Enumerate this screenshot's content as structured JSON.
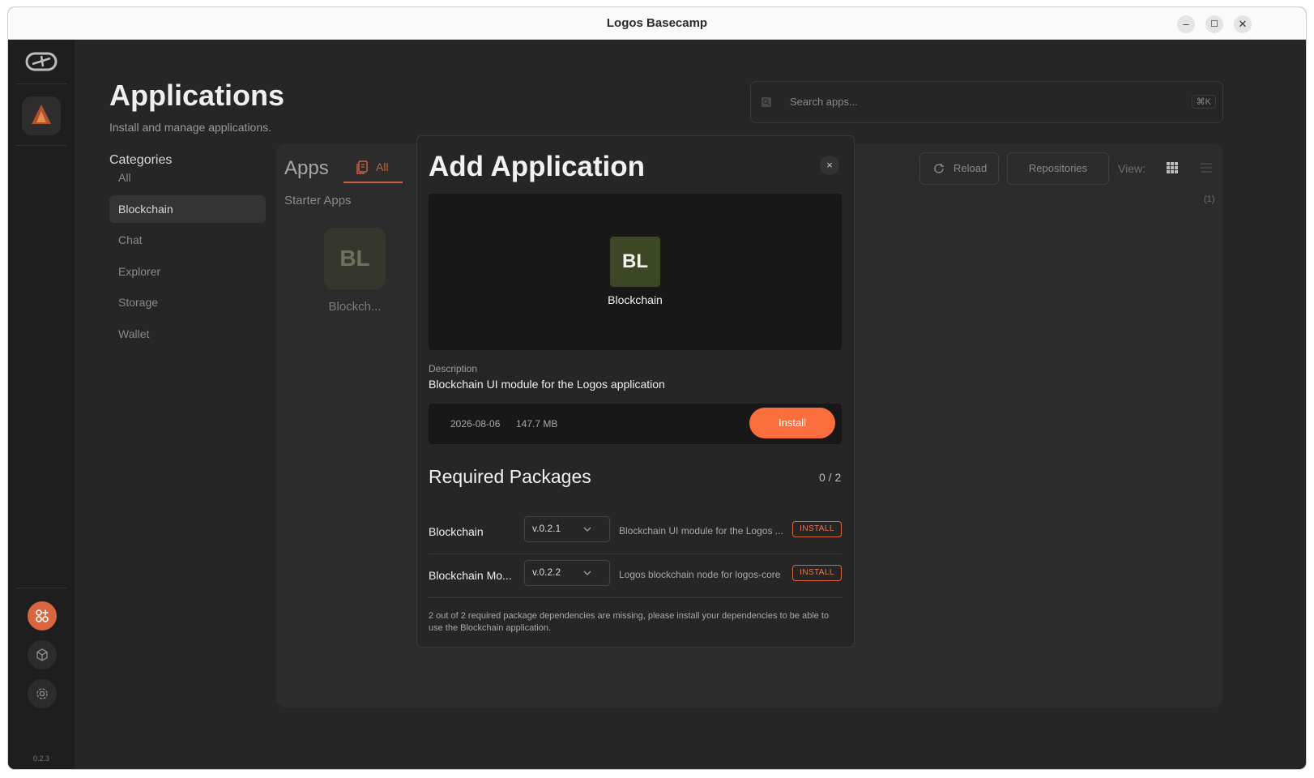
{
  "window": {
    "title": "Logos Basecamp",
    "minimize": "–",
    "maximize": "☐",
    "close": "✕"
  },
  "rail": {
    "version": "0.2.3"
  },
  "header": {
    "title": "Applications",
    "subtitle": "Install and manage applications."
  },
  "search": {
    "placeholder": "Search apps...",
    "shortcut": "⌘K"
  },
  "categories": {
    "title": "Categories",
    "items": [
      "All",
      "Blockchain",
      "Chat",
      "Explorer",
      "Storage",
      "Wallet"
    ],
    "active": "Blockchain"
  },
  "apps_panel": {
    "title": "Apps",
    "tab_all": "All",
    "section": "Starter Apps",
    "app": {
      "initials": "BL",
      "name": "Blockch..."
    },
    "reload_label": "Reload",
    "repositories_label": "Repositories",
    "view_label": "View:",
    "count": "(1)"
  },
  "modal": {
    "title": "Add Application",
    "close": "×",
    "app_initials": "BL",
    "app_name": "Blockchain",
    "description_label": "Description",
    "description": "Blockchain UI module for the Logos application",
    "date": "2026-08-06",
    "size": "147.7 MB",
    "install_label": "Install",
    "required_title": "Required Packages",
    "required_count": "0 / 2",
    "packages": [
      {
        "name": "Blockchain",
        "version": "v.0.2.1",
        "description": "Blockchain UI module for the Logos ...",
        "action": "INSTALL"
      },
      {
        "name": "Blockchain Mo...",
        "version": "v.0.2.2",
        "description": "Logos blockchain node for logos-core",
        "action": "INSTALL"
      }
    ],
    "warning": "2 out of 2 required package dependencies are missing, please install your dependencies to be able to use the Blockchain application."
  },
  "colors": {
    "accent": "#fb6f3e",
    "app_icon_bg": "#3c4723",
    "background": "#262626"
  }
}
